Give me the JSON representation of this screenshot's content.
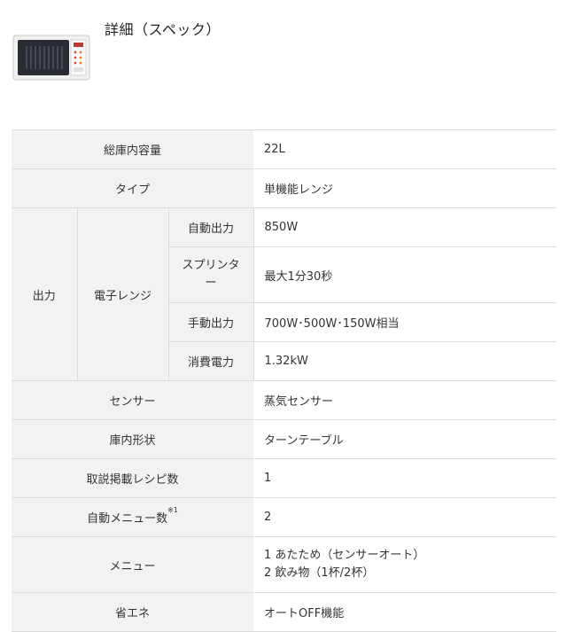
{
  "header": {
    "title": "詳細（スペック）",
    "image_label": "電子レンジ"
  },
  "spec": {
    "capacity_label": "総庫内容量",
    "capacity_value": "22L",
    "type_label": "タイプ",
    "type_value": "単機能レンジ",
    "output_label": "出力",
    "microwave_label": "電子レンジ",
    "auto_output_label": "自動出力",
    "auto_output_value": "850W",
    "sprinter_label": "スプリンター",
    "sprinter_value": "最大1分30秒",
    "manual_output_label": "手動出力",
    "manual_output_value": "700W･500W･150W相当",
    "power_label": "消費電力",
    "power_value": "1.32kW",
    "sensor_label": "センサー",
    "sensor_value": "蒸気センサー",
    "interior_label": "庫内形状",
    "interior_value": "ターンテーブル",
    "recipes_label": "取説掲載レシピ数",
    "recipes_value": "1",
    "auto_menu_label": "自動メニュー数",
    "auto_menu_note": "※1",
    "auto_menu_value": "2",
    "menu_label": "メニュー",
    "menu_line1": "1 あたため（センサーオート）",
    "menu_line2": "2 飲み物（1杯/2杯）",
    "eco_label": "省エネ",
    "eco_value": "オートOFF機能"
  }
}
